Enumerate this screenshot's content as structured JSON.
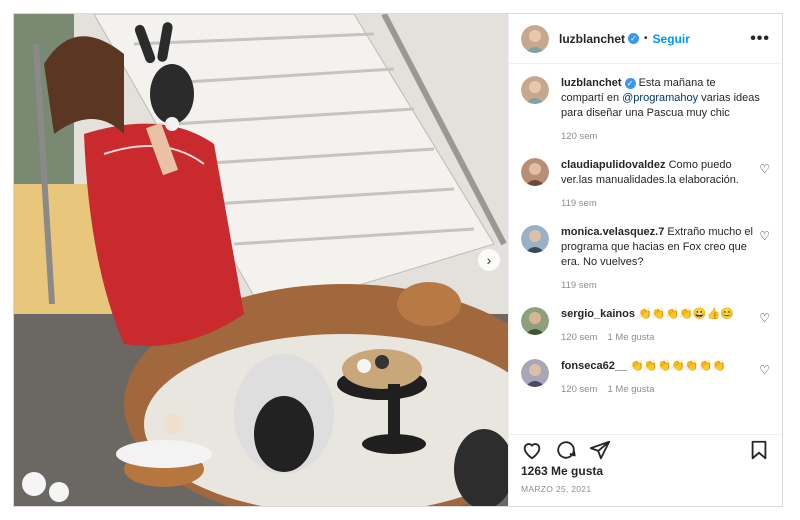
{
  "post": {
    "username": "luzblanchet",
    "follow_label": "Seguir",
    "separator": "•",
    "more_label": "•••",
    "caption": {
      "before_mention": "Esta mañana te compartí en ",
      "mention": "@programahoy",
      "after_mention": " varias ideas para diseñar una Pascua muy chic",
      "time": "120 sem"
    },
    "likes": "1263 Me gusta",
    "date": "MARZO 25, 2021"
  },
  "comments": [
    {
      "user": "claudiapulidovaldez",
      "text": "Como puedo ver.las manualidades.la elaboración.",
      "time": "119 sem",
      "likes": ""
    },
    {
      "user": "monica.velasquez.7",
      "text": "Extraño mucho el programa que hacias en Fox creo que era. No vuelves?",
      "time": "119 sem",
      "likes": ""
    },
    {
      "user": "sergio_kainos",
      "text": "👏👏👏👏😀👍😊",
      "time": "120 sem",
      "likes": "1 Me gusta"
    },
    {
      "user": "fonseca62__",
      "text": "👏👏👏👏👏👏👏",
      "time": "120 sem",
      "likes": "1 Me gusta"
    }
  ],
  "icons": {
    "verified": "verified-badge-icon",
    "heart": "heart-icon",
    "comment": "comment-icon",
    "share": "share-icon",
    "save": "bookmark-icon",
    "more": "more-options-icon",
    "next": "chevron-right-icon"
  },
  "glyphs": {
    "verified": "✓",
    "heart_small": "♡",
    "next": "›"
  },
  "colors": {
    "follow": "#0095f6",
    "verified": "#3897f0",
    "muted": "#8e8e8e"
  }
}
